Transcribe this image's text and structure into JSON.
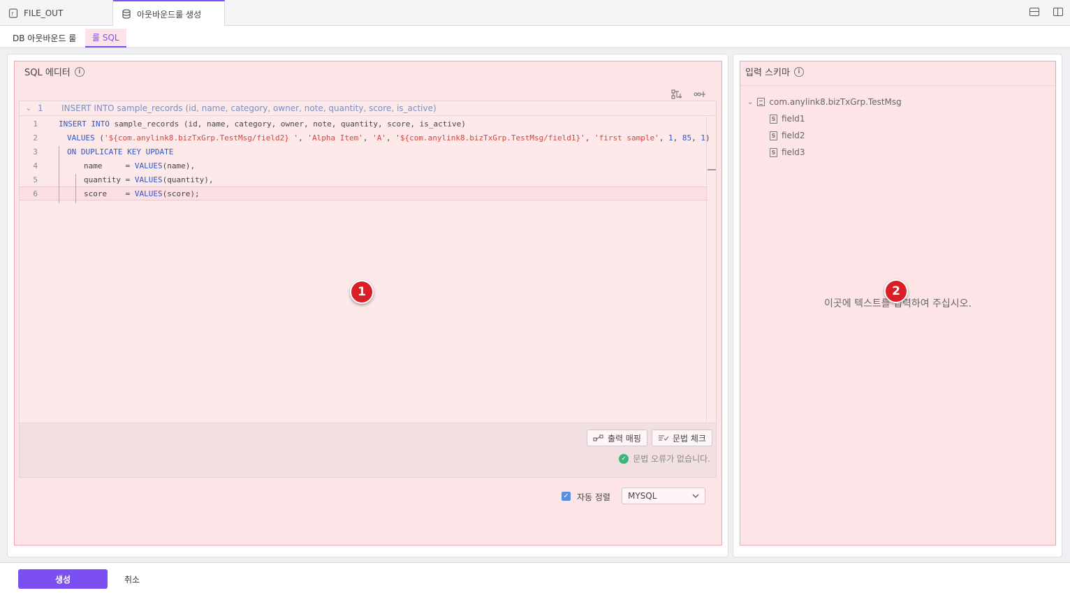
{
  "tabs": [
    {
      "label": "FILE_OUT",
      "icon": "file-icon"
    },
    {
      "label": "아웃바운드룰 생성",
      "icon": "database-icon"
    }
  ],
  "subtabs": [
    {
      "label": "DB 아웃바운드 룰"
    },
    {
      "label": "룰 SQL"
    }
  ],
  "editor_panel": {
    "title": "SQL 에디터",
    "fold_line_number": "1",
    "fold_line_text": "INSERT INTO sample_records (id, name, category, owner, note, quantity, score, is_active)",
    "lines": [
      {
        "n": "1",
        "text": "INSERT INTO sample_records (id, name, category, owner, note, quantity, score, is_active)"
      },
      {
        "n": "2",
        "text": "VALUES ('${com.anylink8.bizTxGrp.TestMsg/field2} ', 'Alpha Item', 'A', '${com.anylink8.bizTxGrp.TestMsg/field1}', 'first sample', 1, 85, 1)"
      },
      {
        "n": "3",
        "text": "ON DUPLICATE KEY UPDATE"
      },
      {
        "n": "4",
        "text": "name     = VALUES(name),"
      },
      {
        "n": "5",
        "text": "quantity = VALUES(quantity),"
      },
      {
        "n": "6",
        "text": "score    = VALUES(score);"
      }
    ],
    "output_mapping_label": "출력 매핑",
    "syntax_check_label": "문법 체크",
    "status_text": "문법 오류가 없습니다.",
    "auto_format_label": "자동 정렬",
    "auto_format_checked": true,
    "dialect_value": "MYSQL"
  },
  "schema_panel": {
    "title": "입력 스키마",
    "root": "com.anylink8.bizTxGrp.TestMsg",
    "fields": [
      "field1",
      "field2",
      "field3"
    ],
    "placeholder": "이곳에 텍스트를 입력하여 주십시오."
  },
  "markers": [
    "1",
    "2"
  ],
  "footer": {
    "create_label": "생성",
    "cancel_label": "취소"
  },
  "colors": {
    "accent": "#7b4ff2",
    "highlight": "#fde4e6",
    "marker": "#d91e26",
    "success": "#3bb678"
  }
}
